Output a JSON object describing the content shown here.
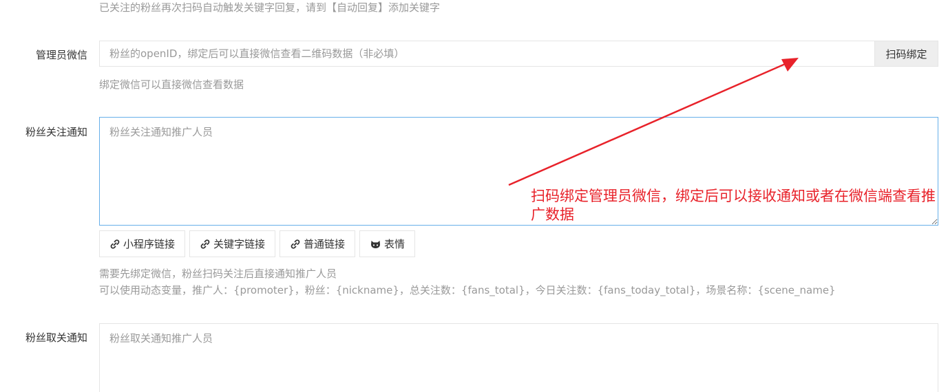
{
  "top_help": "已关注的粉丝再次扫码自动触发关键字回复，请到【自动回复】添加关键字",
  "admin_wechat": {
    "label": "管理员微信",
    "placeholder": "粉丝的openID，绑定后可以直接微信查看二维码数据（非必填）",
    "bind_button": "扫码绑定",
    "help": "绑定微信可以直接微信查看数据"
  },
  "follow_notice": {
    "label": "粉丝关注通知",
    "placeholder": "粉丝关注通知推广人员",
    "toolbar": [
      {
        "label": "小程序链接",
        "icon": "link-icon"
      },
      {
        "label": "关键字链接",
        "icon": "link-icon"
      },
      {
        "label": "普通链接",
        "icon": "link-icon"
      },
      {
        "label": "表情",
        "icon": "github-cat-icon"
      }
    ],
    "help_line1": "需要先绑定微信，粉丝扫码关注后直接通知推广人员",
    "help_line2": "可以使用动态变量，推广人：{promoter}，粉丝：{nickname}，总关注数：{fans_total}，今日关注数：{fans_today_total}，场景名称：{scene_name}"
  },
  "unfollow_notice": {
    "label": "粉丝取关通知",
    "placeholder": "粉丝取关通知推广人员"
  },
  "annotation": {
    "text": "扫码绑定管理员微信，绑定后可以接收通知或者在微信端查看推广数据",
    "color": "#e8222a"
  },
  "colors": {
    "focus_border": "#66afe9",
    "help_text": "#999999",
    "addon_bg": "#eeeeee"
  }
}
